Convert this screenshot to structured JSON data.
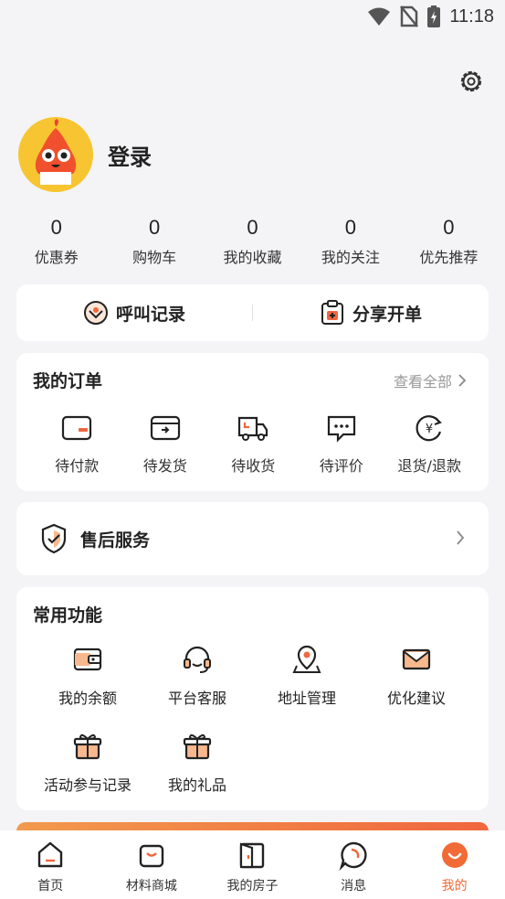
{
  "status": {
    "time": "11:18"
  },
  "profile": {
    "login_label": "登录"
  },
  "stats": [
    {
      "value": "0",
      "label": "优惠券"
    },
    {
      "value": "0",
      "label": "购物车"
    },
    {
      "value": "0",
      "label": "我的收藏"
    },
    {
      "value": "0",
      "label": "我的关注"
    },
    {
      "value": "0",
      "label": "优先推荐"
    }
  ],
  "quick": {
    "call_record": "呼叫记录",
    "share_order": "分享开单"
  },
  "orders": {
    "title": "我的订单",
    "see_all": "查看全部",
    "items": [
      {
        "label": "待付款",
        "icon": "wallet-icon"
      },
      {
        "label": "待发货",
        "icon": "box-icon"
      },
      {
        "label": "待收货",
        "icon": "truck-icon"
      },
      {
        "label": "待评价",
        "icon": "comment-icon"
      },
      {
        "label": "退货/退款",
        "icon": "refund-icon"
      }
    ]
  },
  "after_sales": {
    "label": "售后服务"
  },
  "common": {
    "title": "常用功能",
    "items": [
      {
        "label": "我的余额",
        "icon": "balance-icon"
      },
      {
        "label": "平台客服",
        "icon": "headset-icon"
      },
      {
        "label": "地址管理",
        "icon": "location-icon"
      },
      {
        "label": "优化建议",
        "icon": "mail-icon"
      },
      {
        "label": "活动参与记录",
        "icon": "gift-icon"
      },
      {
        "label": "我的礼品",
        "icon": "gift-icon"
      }
    ]
  },
  "tabs": [
    {
      "label": "首页",
      "icon": "home-icon"
    },
    {
      "label": "材料商城",
      "icon": "shop-icon"
    },
    {
      "label": "我的房子",
      "icon": "door-icon"
    },
    {
      "label": "消息",
      "icon": "message-icon"
    },
    {
      "label": "我的",
      "icon": "profile-icon",
      "active": true
    }
  ],
  "colors": {
    "accent": "#f26a35",
    "avatar_bg": "#f7c531"
  }
}
